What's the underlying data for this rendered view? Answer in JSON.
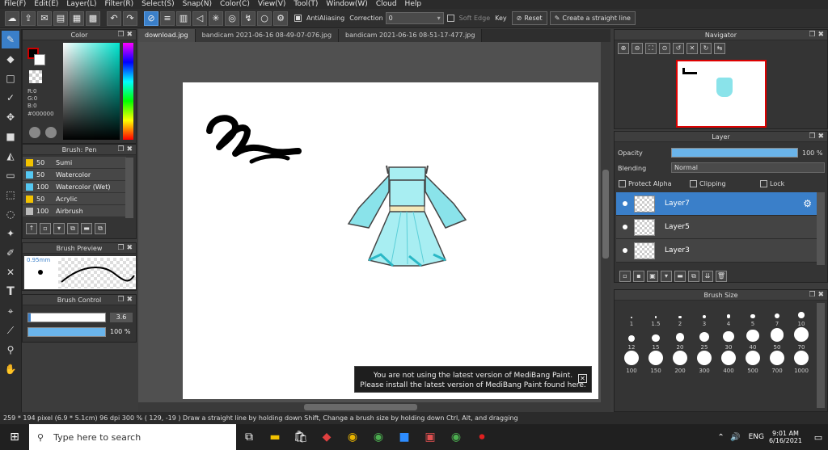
{
  "menu": [
    "File(F)",
    "Edit(E)",
    "Layer(L)",
    "Filter(R)",
    "Select(S)",
    "Snap(N)",
    "Color(C)",
    "View(V)",
    "Tool(T)",
    "Window(W)",
    "Cloud",
    "Help"
  ],
  "toolbar": {
    "antialiasing_label": "AntiAliasing",
    "correction_label": "Correction",
    "correction_value": "0",
    "soft_edge_label": "Soft Edge",
    "key_label": "Key",
    "reset_label": "Reset",
    "straight_line_label": "Create a straight line"
  },
  "tabs": [
    "download.jpg",
    "bandicam 2021-06-16 08-49-07-076.jpg",
    "bandicam 2021-06-16 08-51-17-477.jpg"
  ],
  "color_panel": {
    "title": "Color",
    "r": "R:0",
    "g": "G:0",
    "b": "B:0",
    "hex": "#000000"
  },
  "brush_panel": {
    "title": "Brush: Pen",
    "items": [
      {
        "size": "50",
        "name": "Sumi",
        "color": "#f2c200"
      },
      {
        "size": "50",
        "name": "Watercolor",
        "color": "#55c8f2"
      },
      {
        "size": "100",
        "name": "Watercolor (Wet)",
        "color": "#55c8f2"
      },
      {
        "size": "50",
        "name": "Acrylic",
        "color": "#f2c200"
      },
      {
        "size": "100",
        "name": "Airbrush",
        "color": "#bbbbbb"
      }
    ]
  },
  "brush_preview": {
    "title": "Brush Preview",
    "size": "0.95mm"
  },
  "brush_control": {
    "title": "Brush Control",
    "size_value": "3.6",
    "opacity_value": "100 %",
    "size_fill": 0.88,
    "opacity_fill": 1.0
  },
  "navigator": {
    "title": "Navigator"
  },
  "layer_panel": {
    "title": "Layer",
    "opacity_label": "Opacity",
    "opacity_value": "100 %",
    "blending_label": "Blending",
    "blending_value": "Normal",
    "protect_alpha": "Protect Alpha",
    "clipping": "Clipping",
    "lock": "Lock",
    "layers": [
      "Layer7",
      "Layer5",
      "Layer3"
    ]
  },
  "brush_size": {
    "title": "Brush Size",
    "sizes": [
      "1",
      "1.5",
      "2",
      "3",
      "4",
      "5",
      "7",
      "10",
      "12",
      "15",
      "20",
      "25",
      "30",
      "40",
      "50",
      "70",
      "100",
      "150",
      "200",
      "300",
      "400",
      "500",
      "700",
      "1000"
    ]
  },
  "notice": {
    "line1": "You are not using the latest version of MediBang Paint.",
    "line2": "Please install the latest version of MediBang Paint found here."
  },
  "status": "259 * 194 pixel   (6.9 * 5.1cm)   96 dpi   300 %   ( 129, -19 )   Draw a straight line by holding down Shift, Change a brush size by holding down Ctrl, Alt, and dragging",
  "taskbar": {
    "search_placeholder": "Type here to search",
    "time": "9:01 AM",
    "date": "6/16/2021",
    "lang": "ENG"
  },
  "colors": {
    "accent": "#3a7fc9",
    "dress": "#7fe0e8"
  }
}
